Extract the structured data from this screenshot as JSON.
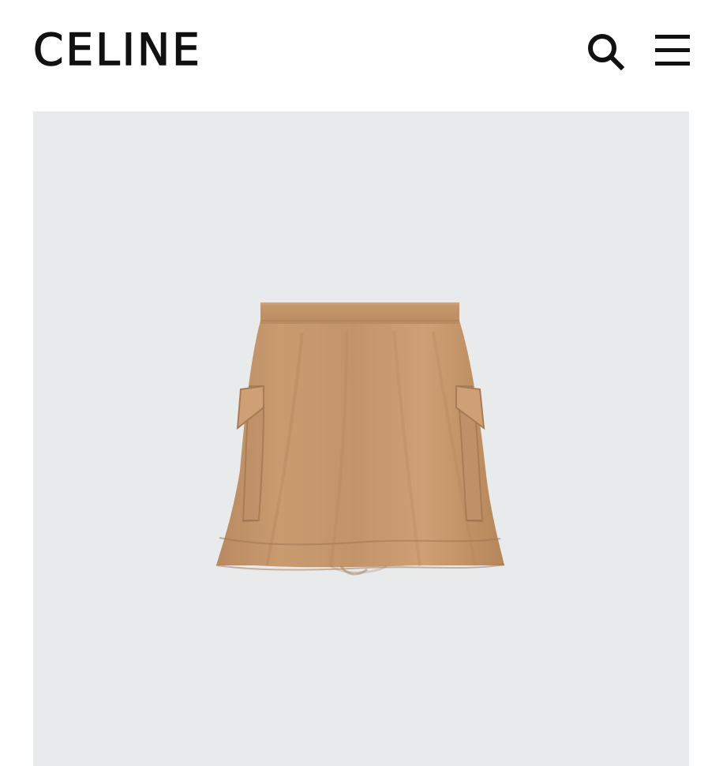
{
  "header": {
    "brand": "CELINE",
    "search_icon": "search-icon",
    "menu_icon": "hamburger-menu-icon"
  },
  "product": {
    "image_icon": "skirt-product-image",
    "colors": {
      "background": "#e9eaeb",
      "fabric": "#c4946a",
      "fabric_shadow": "#ad7f58",
      "fabric_highlight": "#d4a67b"
    }
  }
}
